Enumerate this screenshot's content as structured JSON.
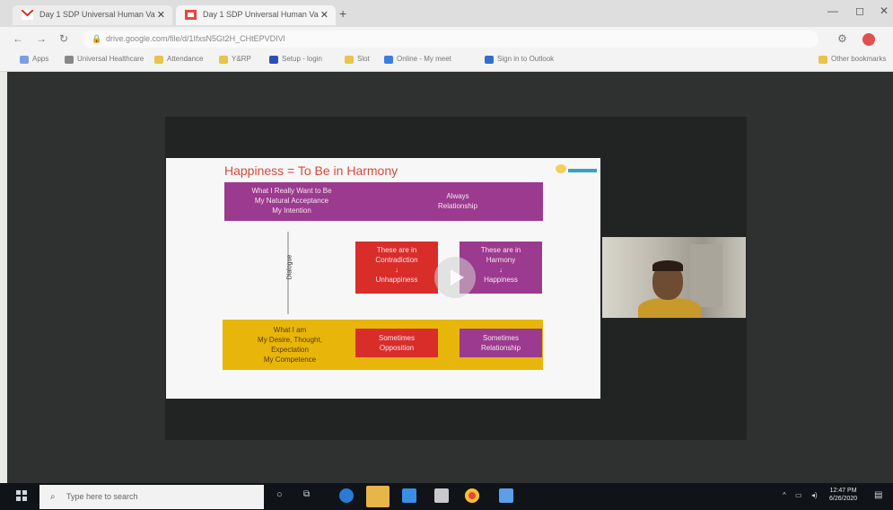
{
  "browser": {
    "tabs": [
      {
        "label": "Day 1 SDP Universal Human Va",
        "favicon": "gmail-icon"
      },
      {
        "label": "Day 1 SDP Universal Human Va",
        "favicon": "slides-icon"
      }
    ],
    "new_tab": "+",
    "url": "drive.google.com/file/d/1IfxsN5Gt2H_CHtEPVDIVl",
    "bookmarks": [
      "Apps",
      "Universal Healthcare",
      "Attendance",
      "Y&RP",
      "Setup - login",
      "Slot",
      "Online - My meet",
      "Sign in to Outlook",
      "Other bookmarks"
    ]
  },
  "slide": {
    "title": "Happiness = To Be in Harmony",
    "top_left": [
      "What I Really Want to Be",
      "My Natural Acceptance",
      "My Intention"
    ],
    "top_right": [
      "Always",
      "Relationship"
    ],
    "vertical_label": "Dialogue",
    "mid_red": [
      "These are in",
      "Contradiction",
      "↓",
      "Unhappiness"
    ],
    "mid_purple": [
      "These are in",
      "Harmony",
      "↓",
      "Happiness"
    ],
    "bottom_left": [
      "What I am",
      "My Desire, Thought,",
      "Expectation",
      "My Competence"
    ],
    "bottom_red": [
      "Sometimes",
      "Opposition"
    ],
    "bottom_purple": [
      "Sometimes",
      "Relationship"
    ]
  },
  "taskbar": {
    "search_placeholder": "Type here to search",
    "time": "12:47 PM",
    "date": "6/26/2020"
  },
  "colors": {
    "title_red": "#d44b3e",
    "purple": "#9b3a8e",
    "red": "#d92d2a",
    "yellow": "#e8b50a"
  }
}
